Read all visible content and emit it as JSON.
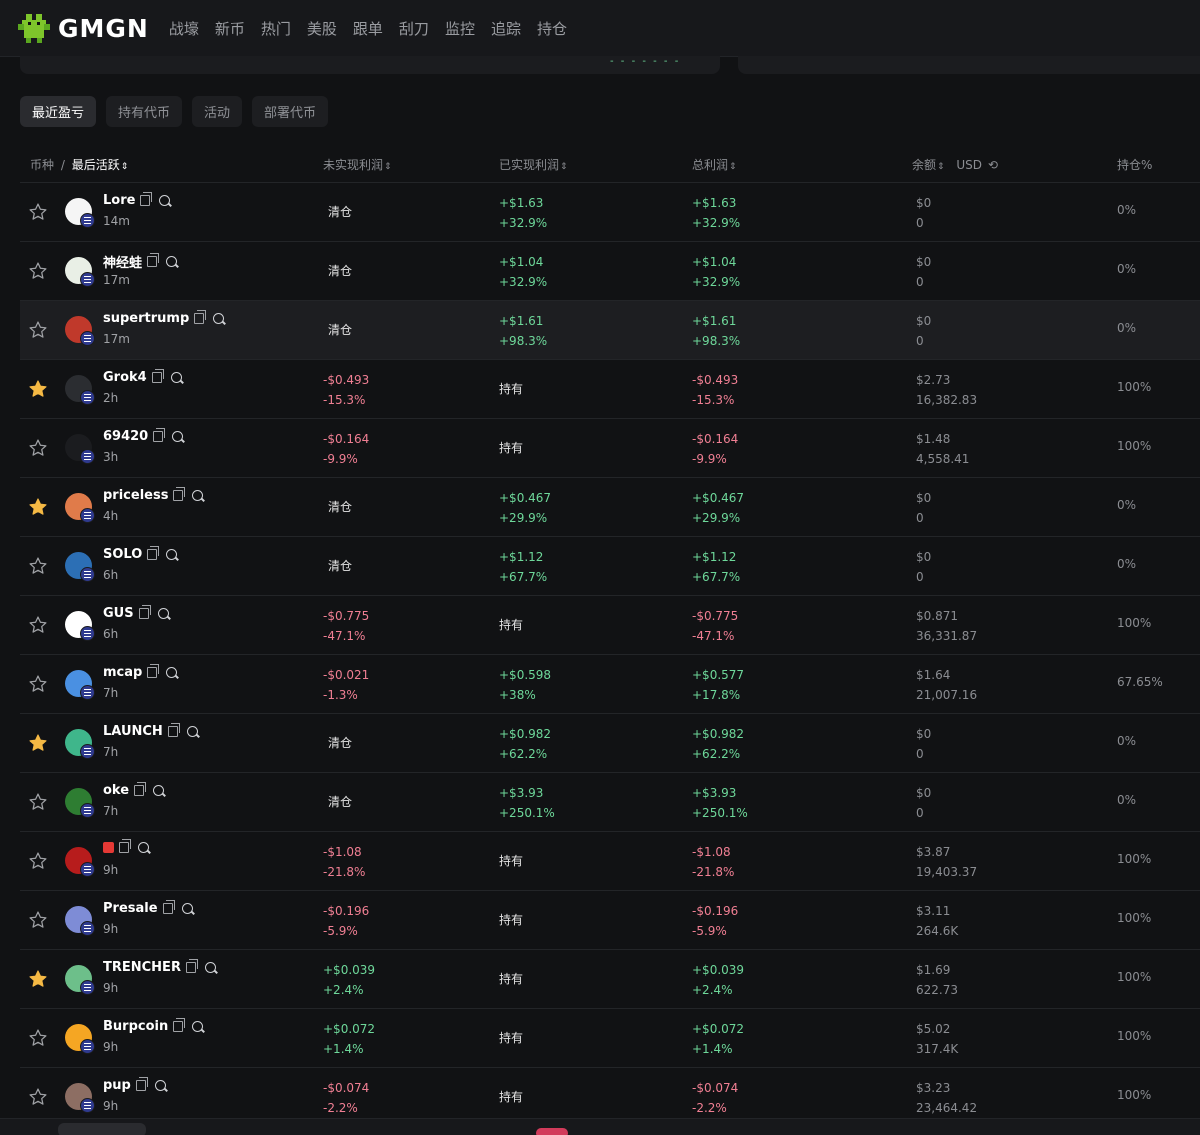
{
  "nav": {
    "logo_text": "GMGN",
    "items": [
      "战壕",
      "新币",
      "热门",
      "美股",
      "跟单",
      "刮刀",
      "监控",
      "追踪",
      "持仓"
    ]
  },
  "top_dashes": "- - - - - - -",
  "tabs": [
    {
      "label": "最近盈亏",
      "active": true
    },
    {
      "label": "持有代币",
      "active": false
    },
    {
      "label": "活动",
      "active": false
    },
    {
      "label": "部署代币",
      "active": false
    }
  ],
  "headers": {
    "coin": "币种",
    "last_active": "最后活跃",
    "unrealized": "未实现利润",
    "realized": "已实现利润",
    "total": "总利润",
    "balance": "余额",
    "currency": "USD",
    "holding": "持仓%"
  },
  "colors": {
    "positive": "#6ed89a",
    "negative": "#f07f93",
    "star": "#f5b944"
  },
  "rows": [
    {
      "name": "Lore",
      "age": "14m",
      "starred": false,
      "unreal_status": "清仓",
      "real_val": "+$1.63",
      "real_pct": "+32.9%",
      "total_val": "+$1.63",
      "total_pct": "+32.9%",
      "bal": "$0",
      "bal_amt": "0",
      "hold": "0%",
      "icon": "#f5f5f5"
    },
    {
      "name": "神经蛙",
      "age": "17m",
      "starred": false,
      "unreal_status": "清仓",
      "real_val": "+$1.04",
      "real_pct": "+32.9%",
      "total_val": "+$1.04",
      "total_pct": "+32.9%",
      "bal": "$0",
      "bal_amt": "0",
      "hold": "0%",
      "icon": "#e9efe6"
    },
    {
      "name": "supertrump",
      "age": "17m",
      "starred": false,
      "unreal_status": "清仓",
      "real_val": "+$1.61",
      "real_pct": "+98.3%",
      "total_val": "+$1.61",
      "total_pct": "+98.3%",
      "bal": "$0",
      "bal_amt": "0",
      "hold": "0%",
      "icon": "#c0392b"
    },
    {
      "name": "Grok4",
      "age": "2h",
      "starred": true,
      "unreal_val": "-$0.493",
      "unreal_pct": "-15.3%",
      "real_status": "持有",
      "total_val": "-$0.493",
      "total_pct": "-15.3%",
      "bal": "$2.73",
      "bal_amt": "16,382.83",
      "hold": "100%",
      "icon": "#2b2d31"
    },
    {
      "name": "69420",
      "age": "3h",
      "starred": false,
      "unreal_val": "-$0.164",
      "unreal_pct": "-9.9%",
      "real_status": "持有",
      "total_val": "-$0.164",
      "total_pct": "-9.9%",
      "bal": "$1.48",
      "bal_amt": "4,558.41",
      "hold": "100%",
      "icon": "#1b1c1f"
    },
    {
      "name": "priceless",
      "age": "4h",
      "starred": true,
      "unreal_status": "清仓",
      "real_val": "+$0.467",
      "real_pct": "+29.9%",
      "total_val": "+$0.467",
      "total_pct": "+29.9%",
      "bal": "$0",
      "bal_amt": "0",
      "hold": "0%",
      "icon": "#e07b4a"
    },
    {
      "name": "SOLO",
      "age": "6h",
      "starred": false,
      "unreal_status": "清仓",
      "real_val": "+$1.12",
      "real_pct": "+67.7%",
      "total_val": "+$1.12",
      "total_pct": "+67.7%",
      "bal": "$0",
      "bal_amt": "0",
      "hold": "0%",
      "icon": "#2c6fb5"
    },
    {
      "name": "GUS",
      "age": "6h",
      "starred": false,
      "unreal_val": "-$0.775",
      "unreal_pct": "-47.1%",
      "real_status": "持有",
      "total_val": "-$0.775",
      "total_pct": "-47.1%",
      "bal": "$0.871",
      "bal_amt": "36,331.87",
      "hold": "100%",
      "icon": "#ffffff"
    },
    {
      "name": "mcap",
      "age": "7h",
      "starred": false,
      "unreal_val": "-$0.021",
      "unreal_pct": "-1.3%",
      "real_val": "+$0.598",
      "real_pct": "+38%",
      "total_val": "+$0.577",
      "total_pct": "+17.8%",
      "bal": "$1.64",
      "bal_amt": "21,007.16",
      "hold": "67.65%",
      "icon": "#4a90e2"
    },
    {
      "name": "LAUNCH",
      "age": "7h",
      "starred": true,
      "unreal_status": "清仓",
      "real_val": "+$0.982",
      "real_pct": "+62.2%",
      "total_val": "+$0.982",
      "total_pct": "+62.2%",
      "bal": "$0",
      "bal_amt": "0",
      "hold": "0%",
      "icon": "#3fb68b"
    },
    {
      "name": "oke",
      "age": "7h",
      "starred": false,
      "unreal_status": "清仓",
      "real_val": "+$3.93",
      "real_pct": "+250.1%",
      "total_val": "+$3.93",
      "total_pct": "+250.1%",
      "bal": "$0",
      "bal_amt": "0",
      "hold": "0%",
      "icon": "#2e7d32"
    },
    {
      "name": "",
      "age": "9h",
      "starred": false,
      "unreal_val": "-$1.08",
      "unreal_pct": "-21.8%",
      "real_status": "持有",
      "total_val": "-$1.08",
      "total_pct": "-21.8%",
      "bal": "$3.87",
      "bal_amt": "19,403.37",
      "hold": "100%",
      "icon": "#b71c1c",
      "name_is_emoji": true
    },
    {
      "name": "Presale",
      "age": "9h",
      "starred": false,
      "unreal_val": "-$0.196",
      "unreal_pct": "-5.9%",
      "real_status": "持有",
      "total_val": "-$0.196",
      "total_pct": "-5.9%",
      "bal": "$3.11",
      "bal_amt": "264.6K",
      "hold": "100%",
      "icon": "#7e8cd6"
    },
    {
      "name": "TRENCHER",
      "age": "9h",
      "starred": true,
      "unreal_val": "+$0.039",
      "unreal_pct": "+2.4%",
      "real_status": "持有",
      "total_val": "+$0.039",
      "total_pct": "+2.4%",
      "bal": "$1.69",
      "bal_amt": "622.73",
      "hold": "100%",
      "icon": "#6dbf8a"
    },
    {
      "name": "Burpcoin",
      "age": "9h",
      "starred": false,
      "unreal_val": "+$0.072",
      "unreal_pct": "+1.4%",
      "real_status": "持有",
      "total_val": "+$0.072",
      "total_pct": "+1.4%",
      "bal": "$5.02",
      "bal_amt": "317.4K",
      "hold": "100%",
      "icon": "#f5a623"
    },
    {
      "name": "pup",
      "age": "9h",
      "starred": false,
      "unreal_val": "-$0.074",
      "unreal_pct": "-2.2%",
      "real_status": "持有",
      "total_val": "-$0.074",
      "total_pct": "-2.2%",
      "bal": "$3.23",
      "bal_amt": "23,464.42",
      "hold": "100%",
      "icon": "#8d6e63"
    }
  ]
}
